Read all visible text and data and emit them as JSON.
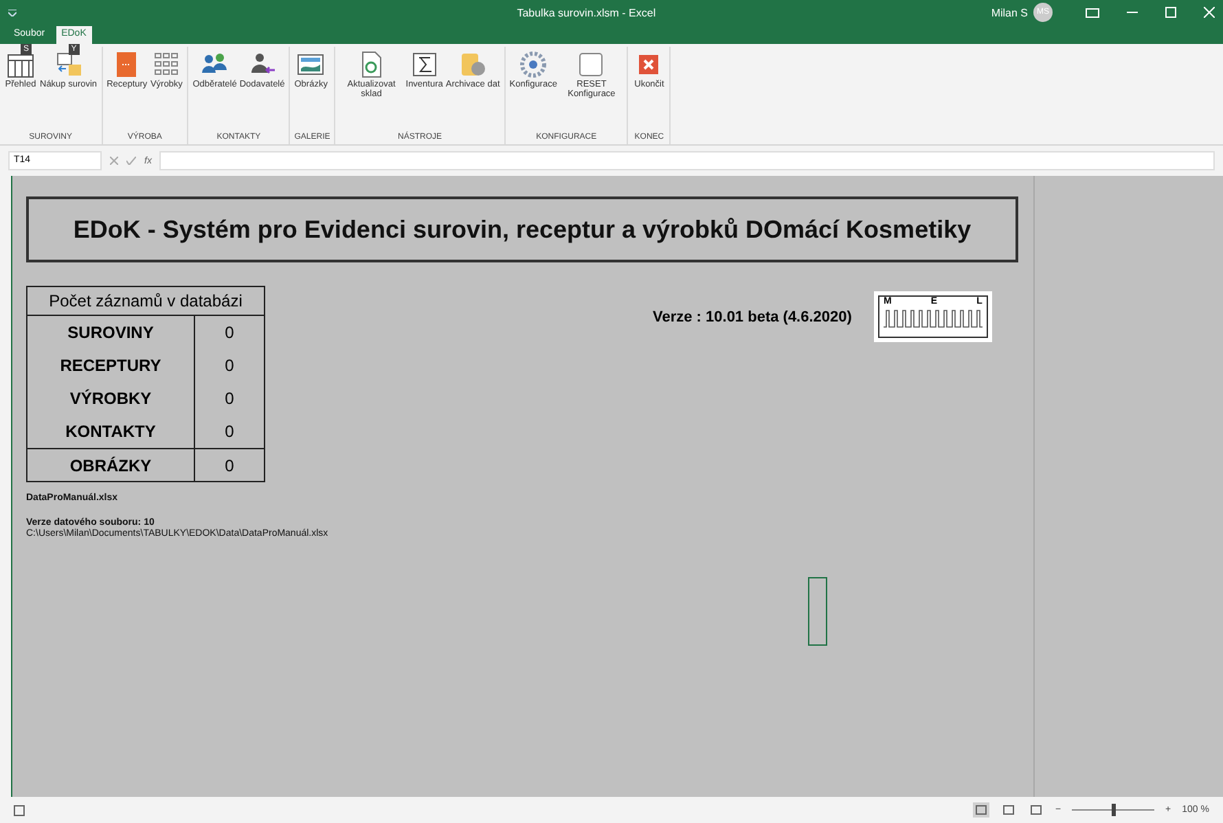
{
  "window": {
    "title": "Tabulka surovin.xlsm - Excel",
    "user": "Milan S",
    "avatar": "MS"
  },
  "tabs": [
    {
      "label": "Soubor",
      "selected": false
    },
    {
      "label": "EDoK",
      "selected": true
    }
  ],
  "ribbon": {
    "groups": [
      {
        "label": "SUROVINY",
        "buttons": [
          {
            "label": "Přehled",
            "keytip": "S"
          },
          {
            "label": "Nákup surovin",
            "keytip": "Y"
          }
        ]
      },
      {
        "label": "VÝROBA",
        "buttons": [
          {
            "label": "Receptury"
          },
          {
            "label": "Výrobky"
          }
        ]
      },
      {
        "label": "KONTAKTY",
        "buttons": [
          {
            "label": "Odběratelé"
          },
          {
            "label": "Dodavatelé"
          }
        ]
      },
      {
        "label": "GALERIE",
        "buttons": [
          {
            "label": "Obrázky"
          }
        ]
      },
      {
        "label": "NÁSTROJE",
        "buttons": [
          {
            "label": "Aktualizovat sklad"
          },
          {
            "label": "Inventura"
          },
          {
            "label": "Archivace dat"
          }
        ]
      },
      {
        "label": "KONFIGURACE",
        "buttons": [
          {
            "label": "Konfigurace"
          },
          {
            "label": "RESET Konfigurace"
          }
        ]
      },
      {
        "label": "KONEC",
        "buttons": [
          {
            "label": "Ukončit"
          }
        ]
      }
    ]
  },
  "formula_bar": {
    "name_box": "T14",
    "fx": "fx"
  },
  "sheet": {
    "title": "EDoK - Systém pro Evidenci surovin, receptur a výrobků DOmácí Kosmetiky",
    "counts": {
      "header": "Počet záznamů v databázi",
      "rows": [
        {
          "label": "SUROVINY",
          "value": "0",
          "separated": false
        },
        {
          "label": "RECEPTURY",
          "value": "0",
          "separated": false
        },
        {
          "label": "VÝROBKY",
          "value": "0",
          "separated": false
        },
        {
          "label": "KONTAKTY",
          "value": "0",
          "separated": false
        },
        {
          "label": "OBRÁZKY",
          "value": "0",
          "separated": true
        }
      ]
    },
    "version": "Verze : 10.01 beta (4.6.2020)",
    "logo": {
      "letters": [
        "M",
        "E",
        "L"
      ]
    },
    "file_name": "DataProManuál.xlsx",
    "file_version": "Verze datového souboru:  10",
    "file_path": "C:\\Users\\Milan\\Documents\\TABULKY\\EDOK\\Data\\DataProManuál.xlsx"
  },
  "status_bar": {
    "zoom": "100 %",
    "minus": "−",
    "plus": "+",
    "zoom_slider": {
      "level": 0.5
    },
    "views": [
      {
        "selected": true
      },
      {
        "selected": false
      },
      {
        "selected": false
      }
    ]
  }
}
